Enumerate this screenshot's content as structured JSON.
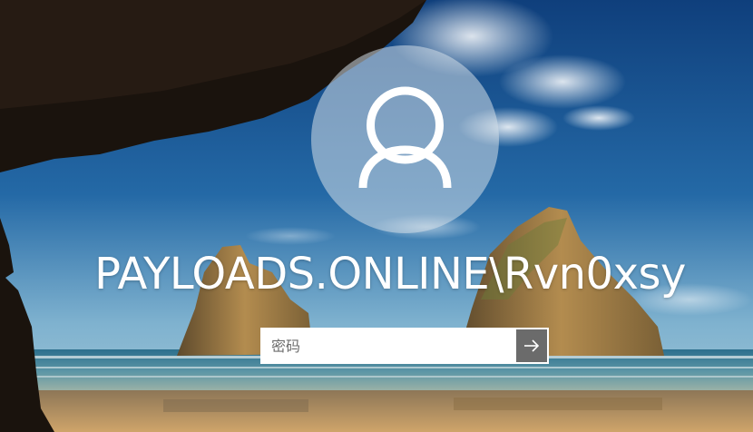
{
  "login": {
    "username": "PAYLOADS.ONLINE\\Rvn0xsy",
    "password_placeholder": "密码",
    "password_value": ""
  },
  "icons": {
    "avatar": "user-silhouette-icon",
    "submit": "arrow-right-icon"
  },
  "colors": {
    "avatar_circle": "#d4dee8",
    "submit_button": "#6b6b6b",
    "text": "#ffffff"
  }
}
